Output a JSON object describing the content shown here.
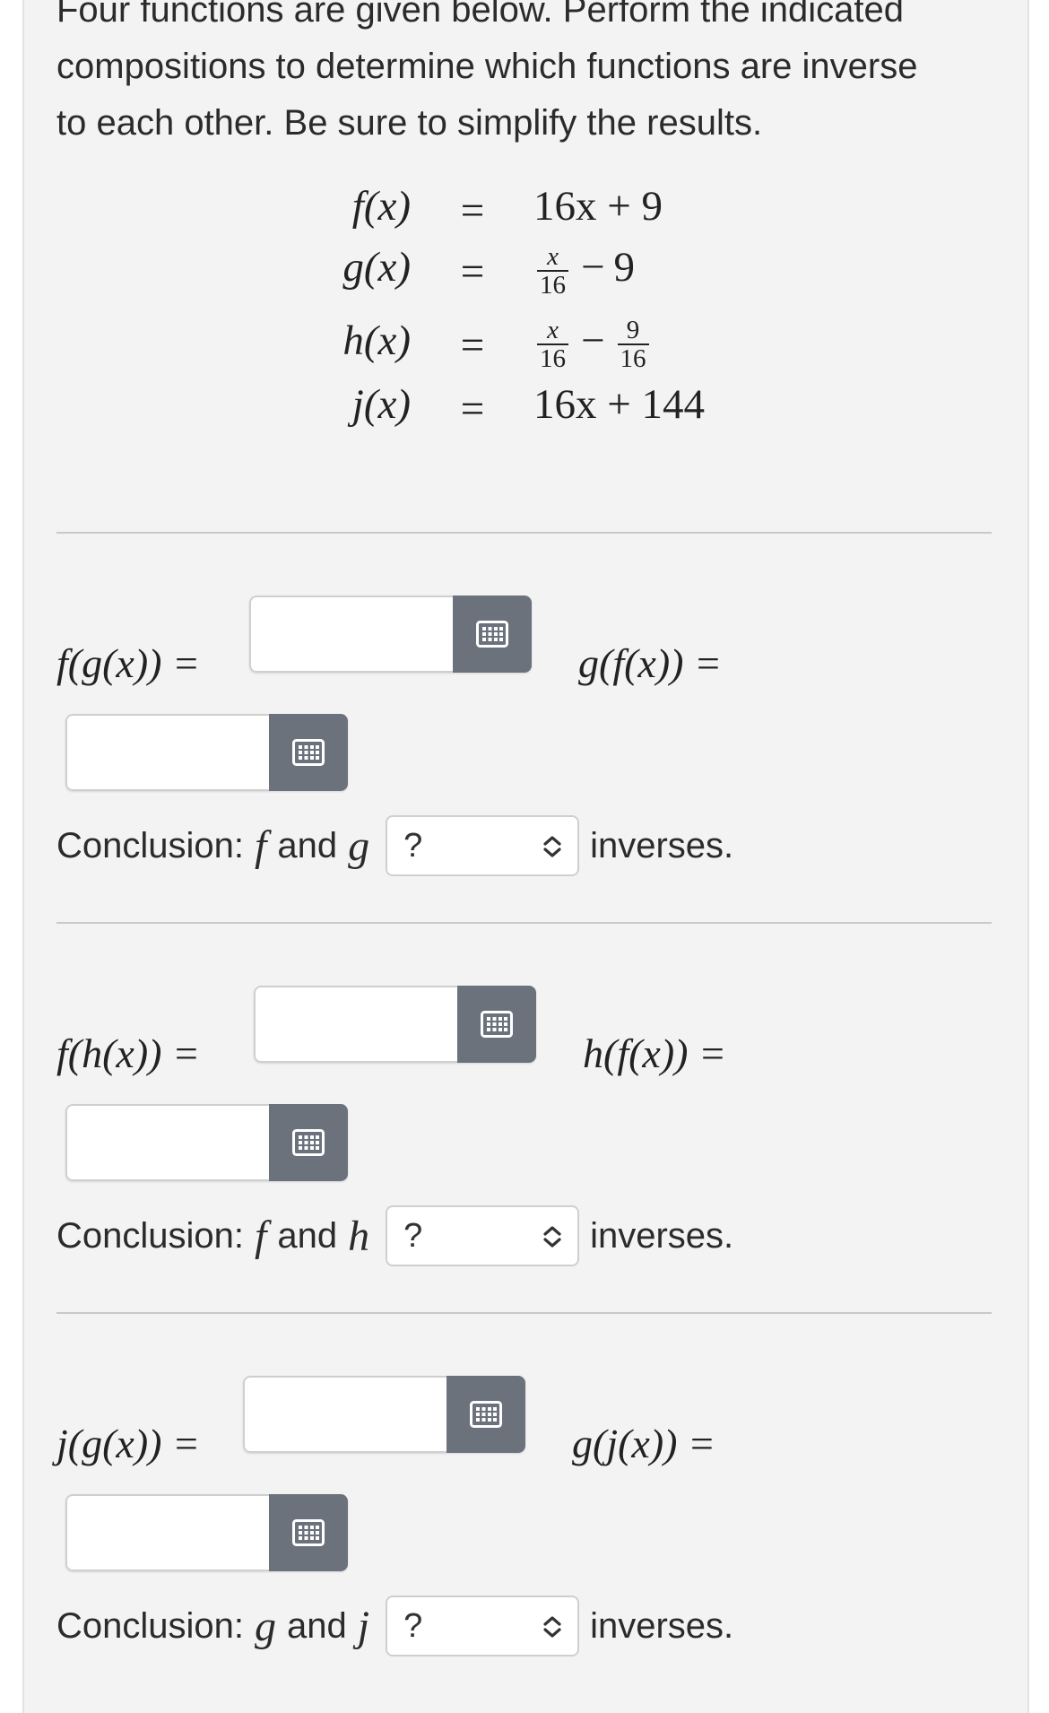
{
  "intro": {
    "line1": "Four functions are given below. Perform the indicated",
    "line2": "compositions to determine which functions are inverse",
    "line3": "to each other. Be sure to simplify the results."
  },
  "functions": {
    "f": {
      "lhs": "f(x)",
      "rhs": "16x + 9"
    },
    "g": {
      "lhs": "g(x)",
      "x": "x",
      "den1": "16",
      "minus": "−",
      "const": "9"
    },
    "h": {
      "lhs": "h(x)",
      "x": "x",
      "den1": "16",
      "minus": "−",
      "num2": "9",
      "den2": "16"
    },
    "j": {
      "lhs": "j(x)",
      "rhs": "16x + 144"
    },
    "equals": "="
  },
  "sections": [
    {
      "comp1_label": "f(g(x)) =",
      "comp2_label": "g(f(x)) =",
      "conclusion": {
        "prefix": "Conclusion:",
        "var1": "f",
        "and": "and",
        "var2": "g",
        "select_value": "?",
        "suffix": "inverses."
      }
    },
    {
      "comp1_label": "f(h(x)) =",
      "comp2_label": "h(f(x)) =",
      "conclusion": {
        "prefix": "Conclusion:",
        "var1": "f",
        "and": "and",
        "var2": "h",
        "select_value": "?",
        "suffix": "inverses."
      }
    },
    {
      "comp1_label": "j(g(x)) =",
      "comp2_label": "g(j(x)) =",
      "conclusion": {
        "prefix": "Conclusion:",
        "var1": "g",
        "and": "and",
        "var2": "j",
        "select_value": "?",
        "suffix": "inverses."
      }
    }
  ],
  "icons": {
    "answer_button": "keypad-icon",
    "select": "chevron-up-down-icon"
  },
  "colors": {
    "card_background": "#f3f3f3",
    "keypad_button": "#6c727c",
    "divider": "#c9c9c9"
  }
}
